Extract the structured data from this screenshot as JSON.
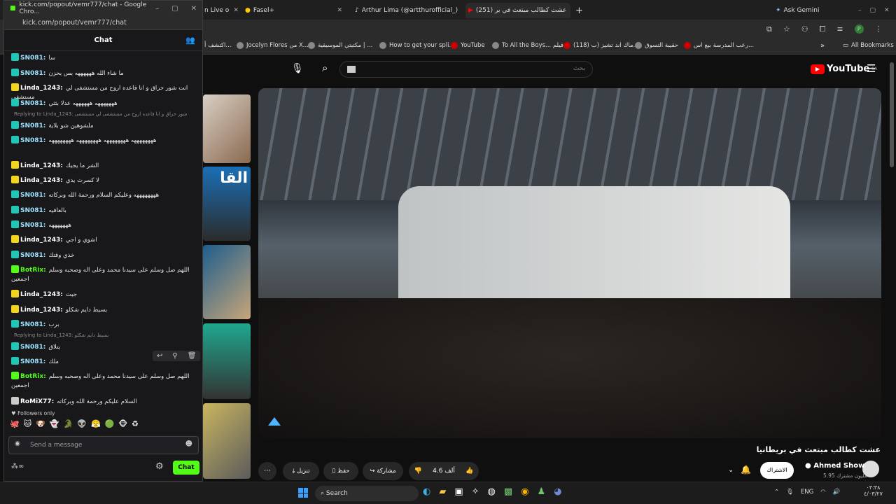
{
  "popup": {
    "window_title": "kick.com/popout/vemr777/chat - Google Chro...",
    "url": "kick.com/popout/vemr777/chat",
    "chat_title": "Chat",
    "followers_only": "Followers only",
    "message_placeholder": "Send a message",
    "chat_button": "Chat",
    "messages": [
      {
        "user": "SN081:",
        "color": "#9be2ff",
        "text": "سا"
      },
      {
        "user": "SN081:",
        "color": "#9be2ff",
        "text": "ما شاء الله ههههههه بس بحزن"
      },
      {
        "user": "Linda_1243:",
        "color": "#ffffff",
        "text": "انت شور حراق و انا فاعده اروح من مستشفى لي مستشفى"
      },
      {
        "user": "SN081:",
        "color": "#9be2ff",
        "text": "هههههههه ههههههه عدلا بثثي"
      },
      {
        "user": "SN081:",
        "color": "#9be2ff",
        "text": "ملشوهين شو بلاية"
      },
      {
        "user": "SN081:",
        "color": "#9be2ff",
        "text": "ههههههههه ههههههههه ههههههههه ههههههههه"
      },
      {
        "user": "Linda_1243:",
        "color": "#ffffff",
        "text": "الشر ما يجيك"
      },
      {
        "user": "Linda_1243:",
        "color": "#ffffff",
        "text": "لا كسرت يدي"
      },
      {
        "user": "SN081:",
        "color": "#9be2ff",
        "text": "ههههههههه وعليكم السلام ورحمة الله وبركاته"
      },
      {
        "user": "SN081:",
        "color": "#9be2ff",
        "text": "بالعافيه"
      },
      {
        "user": "SN081:",
        "color": "#9be2ff",
        "text": "هههههههه"
      },
      {
        "user": "Linda_1243:",
        "color": "#ffffff",
        "text": "اشوي و اجي"
      },
      {
        "user": "SN081:",
        "color": "#9be2ff",
        "text": "خذي وقتك"
      },
      {
        "user": "BotRix:",
        "color": "#53fc18",
        "text": "اللهم صل وسلم على سيدنا محمد وعلى اله وصحبه وسلم اجمعين"
      },
      {
        "user": "Linda_1243:",
        "color": "#ffffff",
        "text": "جيت"
      },
      {
        "user": "Linda_1243:",
        "color": "#ffffff",
        "text": "بسيط دايم شكلو"
      },
      {
        "user": "SN081:",
        "color": "#9be2ff",
        "text": "برب"
      },
      {
        "user": "SN081:",
        "color": "#9be2ff",
        "text": "يتلاق"
      },
      {
        "user": "SN081:",
        "color": "#9be2ff",
        "text": "ملك"
      },
      {
        "user": "BotRix:",
        "color": "#53fc18",
        "text": "اللهم صل وسلم على سيدنا محمد وعلى اله وصحبه وسلم اجمعين"
      },
      {
        "user": "RoMiX77:",
        "color": "#ffffff",
        "text": "السلام عليكم ورحمة الله وبركاته"
      }
    ],
    "replies": [
      {
        "text": "Replying to Linda_1243: انت شور حراق و انا فاعده اروح من مستشفى لي مستشفى"
      },
      {
        "text": "Replying to Linda_1243: بسيط دايم شكلو"
      }
    ]
  },
  "browser": {
    "tabs": [
      {
        "label": "n Live o"
      },
      {
        "label": "Fasel+"
      },
      {
        "label": "Arthur Lima (@artthurofficial_)"
      },
      {
        "label": "(251) عشت كطالب مبتعث في بر"
      }
    ],
    "ask_gemini": "Ask Gemini",
    "bookmarks": [
      "اكتشف أ...",
      "Jocelyn Flores من X...",
      "مكتبتي الموسيقية | ...",
      "How to get your spli...",
      "YouTube",
      "To All the Boys... فيلم",
      "(118) ماك اند تشيز (ب...",
      "حقيبة التسوق",
      "رعب المدرسة بيع اس..."
    ],
    "all_bookmarks": "All Bookmarks"
  },
  "youtube": {
    "logo": "YouTube",
    "region": "SA",
    "search_placeholder": "بحث",
    "video_title": "عشت كطالب مبتعث في بريطانيا",
    "channel": "Ahmed Show",
    "subscribers": "5.95 مليون مشترك",
    "subscribe": "الاشتراك",
    "likes": "4.6 ألف",
    "share": "مشاركة",
    "save": "حفظ",
    "download": "تنزيل"
  },
  "taskbar": {
    "search": "Search",
    "lang": "ENG",
    "time": "٠٣:٣٨",
    "date": "٤/٠٣/٢٧"
  }
}
